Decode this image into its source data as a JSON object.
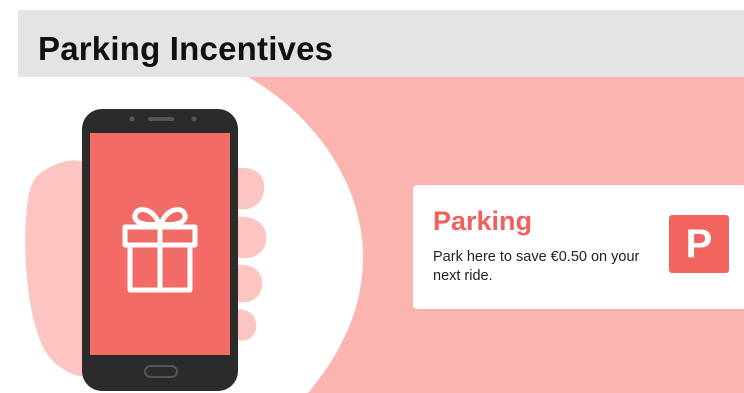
{
  "header": {
    "title": "Parking Incentives"
  },
  "card": {
    "title": "Parking",
    "body": "Park here to save €0.50 on your next ride.",
    "badge_letter": "P"
  },
  "colors": {
    "header_bg": "#e4e4e4",
    "hero_pink": "#fbb4b0",
    "accent": "#f0605e",
    "phone_body": "#2b2b2b",
    "phone_screen": "#f26b66",
    "skin": "#fcc5c1"
  },
  "icons": {
    "phone": "smartphone-icon",
    "gift": "gift-icon",
    "hand": "hand-icon",
    "parking": "parking-sign-icon"
  }
}
